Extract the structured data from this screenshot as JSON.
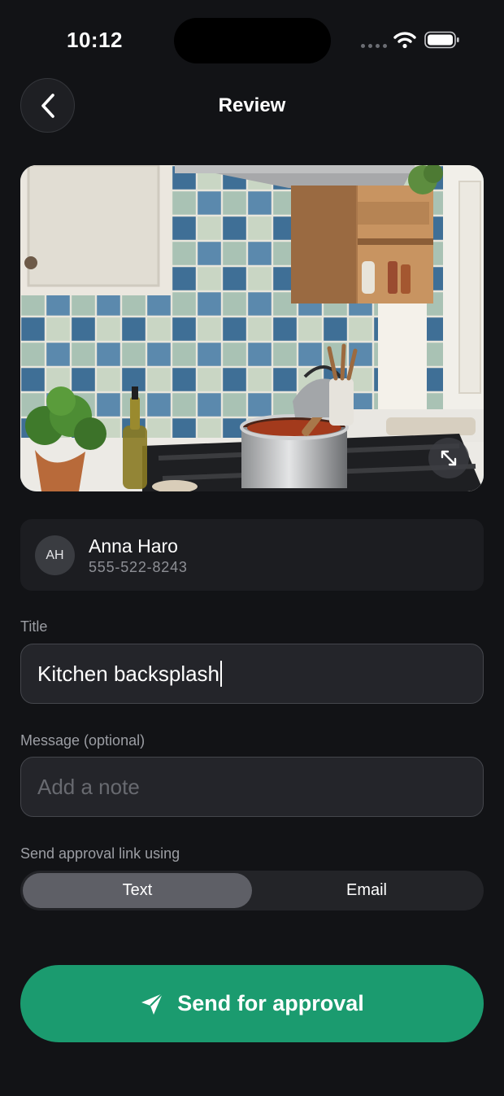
{
  "status_bar": {
    "time": "10:12"
  },
  "header": {
    "title": "Review"
  },
  "contact": {
    "initials": "AH",
    "name": "Anna Haro",
    "phone": "555-522-8243"
  },
  "form": {
    "title_label": "Title",
    "title_value": "Kitchen backsplash",
    "message_label": "Message (optional)",
    "message_placeholder": "Add a note",
    "send_via_label": "Send approval link using",
    "send_via_options": [
      "Text",
      "Email"
    ],
    "send_via_selected": "Text"
  },
  "actions": {
    "send_label": "Send for approval"
  },
  "icons": {
    "back": "chevron-left-icon",
    "expand": "expand-icon",
    "send": "paper-plane-icon",
    "wifi": "wifi-icon",
    "battery": "battery-icon"
  },
  "colors": {
    "background": "#121316",
    "accent": "#1b9b6f",
    "segment_active": "#5e5f66"
  }
}
